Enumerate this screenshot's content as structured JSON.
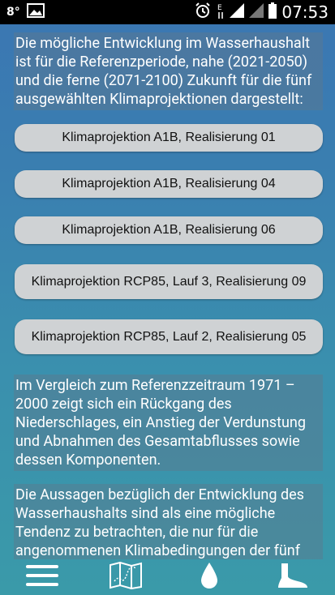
{
  "statusbar": {
    "temperature": "8°",
    "time": "07:53"
  },
  "intro": {
    "text": "Die mögliche Entwicklung im Wasserhaushalt ist für die Referenzperiode, nahe (2021-2050) und die ferne (2071-2100) Zukunft für die fünf ausgewählten Klimaprojektionen dargestellt:"
  },
  "buttons": [
    {
      "label": "Klimaprojektion A1B, Realisierung 01"
    },
    {
      "label": "Klimaprojektion A1B, Realisierung 04"
    },
    {
      "label": "Klimaprojektion A1B, Realisierung 06"
    },
    {
      "label": "Klimaprojektion RCP85, Lauf 3, Realisierung 09"
    },
    {
      "label": "Klimaprojektion RCP85, Lauf 2, Realisierung 05"
    }
  ],
  "comparison": {
    "text": "Im Vergleich zum Referenzzeitraum 1971 – 2000 zeigt sich ein Rückgang des Niederschlages, ein Anstieg der Verdunstung und Abnahmen des Gesamtabflusses sowie dessen Komponenten."
  },
  "note": {
    "text": "Die Aussagen bezüglich der Entwicklung des Wasserhaushalts sind als eine mögliche Tendenz zu betrachten, die nur für die angenommenen Klimabedingungen der fünf"
  },
  "bottombar": {
    "icons": [
      "menu-icon",
      "map-icon",
      "water-drop-icon",
      "boot-icon"
    ]
  }
}
